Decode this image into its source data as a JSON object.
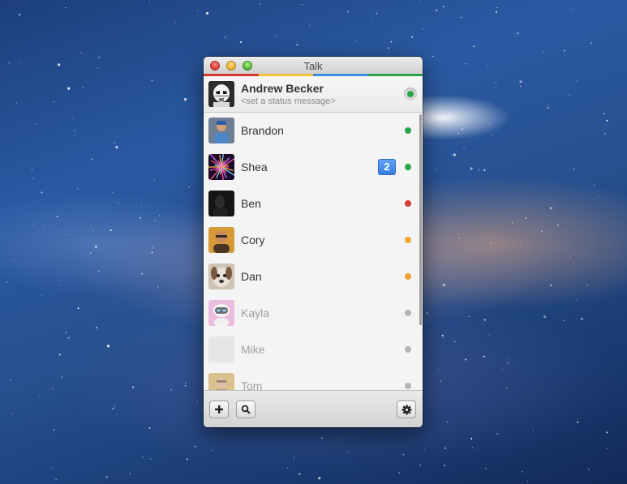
{
  "window": {
    "title": "Talk",
    "color_stripe": [
      "#d43a2f",
      "#f3c33a",
      "#3a8ee6",
      "#2fa34a"
    ]
  },
  "me": {
    "name": "Andrew Becker",
    "status_placeholder": "<set a status message>",
    "presence": "available",
    "avatar_icon": "stormtrooper-avatar"
  },
  "presence_colors": {
    "available": "#2aa44a",
    "busy": "#d63b3b",
    "away": "#f0a232",
    "offline": "#b5b5b5"
  },
  "contacts": [
    {
      "name": "Brandon",
      "presence": "available",
      "badge": null,
      "avatar_icon": "photo-avatar"
    },
    {
      "name": "Shea",
      "presence": "available",
      "badge": "2",
      "avatar_icon": "fireworks-avatar"
    },
    {
      "name": "Ben",
      "presence": "busy",
      "badge": null,
      "avatar_icon": "dark-photo-avatar"
    },
    {
      "name": "Cory",
      "presence": "away",
      "badge": null,
      "avatar_icon": "photo-avatar"
    },
    {
      "name": "Dan",
      "presence": "away",
      "badge": null,
      "avatar_icon": "dog-avatar"
    },
    {
      "name": "Kayla",
      "presence": "offline",
      "badge": null,
      "avatar_icon": "robot-avatar"
    },
    {
      "name": "Mike",
      "presence": "offline",
      "badge": null,
      "avatar_icon": "blank-avatar"
    },
    {
      "name": "Tom",
      "presence": "offline",
      "badge": null,
      "avatar_icon": "photo-avatar"
    }
  ],
  "footer": {
    "buttons": [
      "add-icon",
      "search-icon",
      "gear-icon"
    ]
  }
}
